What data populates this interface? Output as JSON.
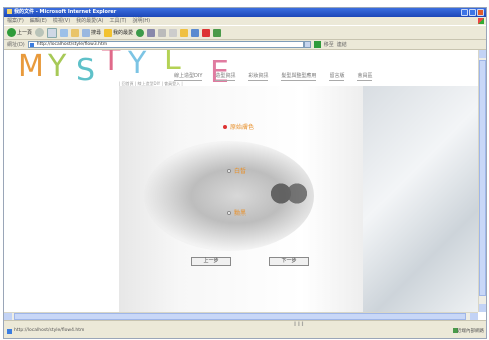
{
  "window": {
    "title": "我的文件 - Microsoft Internet Explorer"
  },
  "menu": [
    "檔案(F)",
    "編輯(E)",
    "檢視(V)",
    "我的最愛(A)",
    "工具(T)",
    "說明(H)"
  ],
  "toolbar": {
    "back_label": "上一頁",
    "search_label": "搜尋",
    "favorites_label": "我的最愛"
  },
  "address": {
    "label": "網址(D)",
    "value": "http://localhost/style/flow3.htm",
    "go_label": "移至",
    "links_label": "連結"
  },
  "site": {
    "logo_letters": [
      "M",
      "Y",
      "S",
      "T",
      "Y",
      "L",
      "E"
    ],
    "nav": [
      "線上造型DIY",
      "造型資訊",
      "彩妝資訊",
      "髮型與整型應用",
      "留言版",
      "會員區"
    ],
    "subnav": "| 回首頁 | 線上造型DIY | 會員登入 |"
  },
  "colors": {
    "accent": "#e8912c",
    "radio_selected": "#dd3333"
  },
  "form": {
    "options": [
      {
        "label": "原始膚色",
        "selected": true
      },
      {
        "label": "白皙",
        "selected": false
      },
      {
        "label": "黝黑",
        "selected": false
      }
    ],
    "prev_button": "上一步",
    "next_button": "下一步"
  },
  "status": {
    "left": "http://localhost/style/flow4.htm",
    "zone": "近端內部網路"
  }
}
